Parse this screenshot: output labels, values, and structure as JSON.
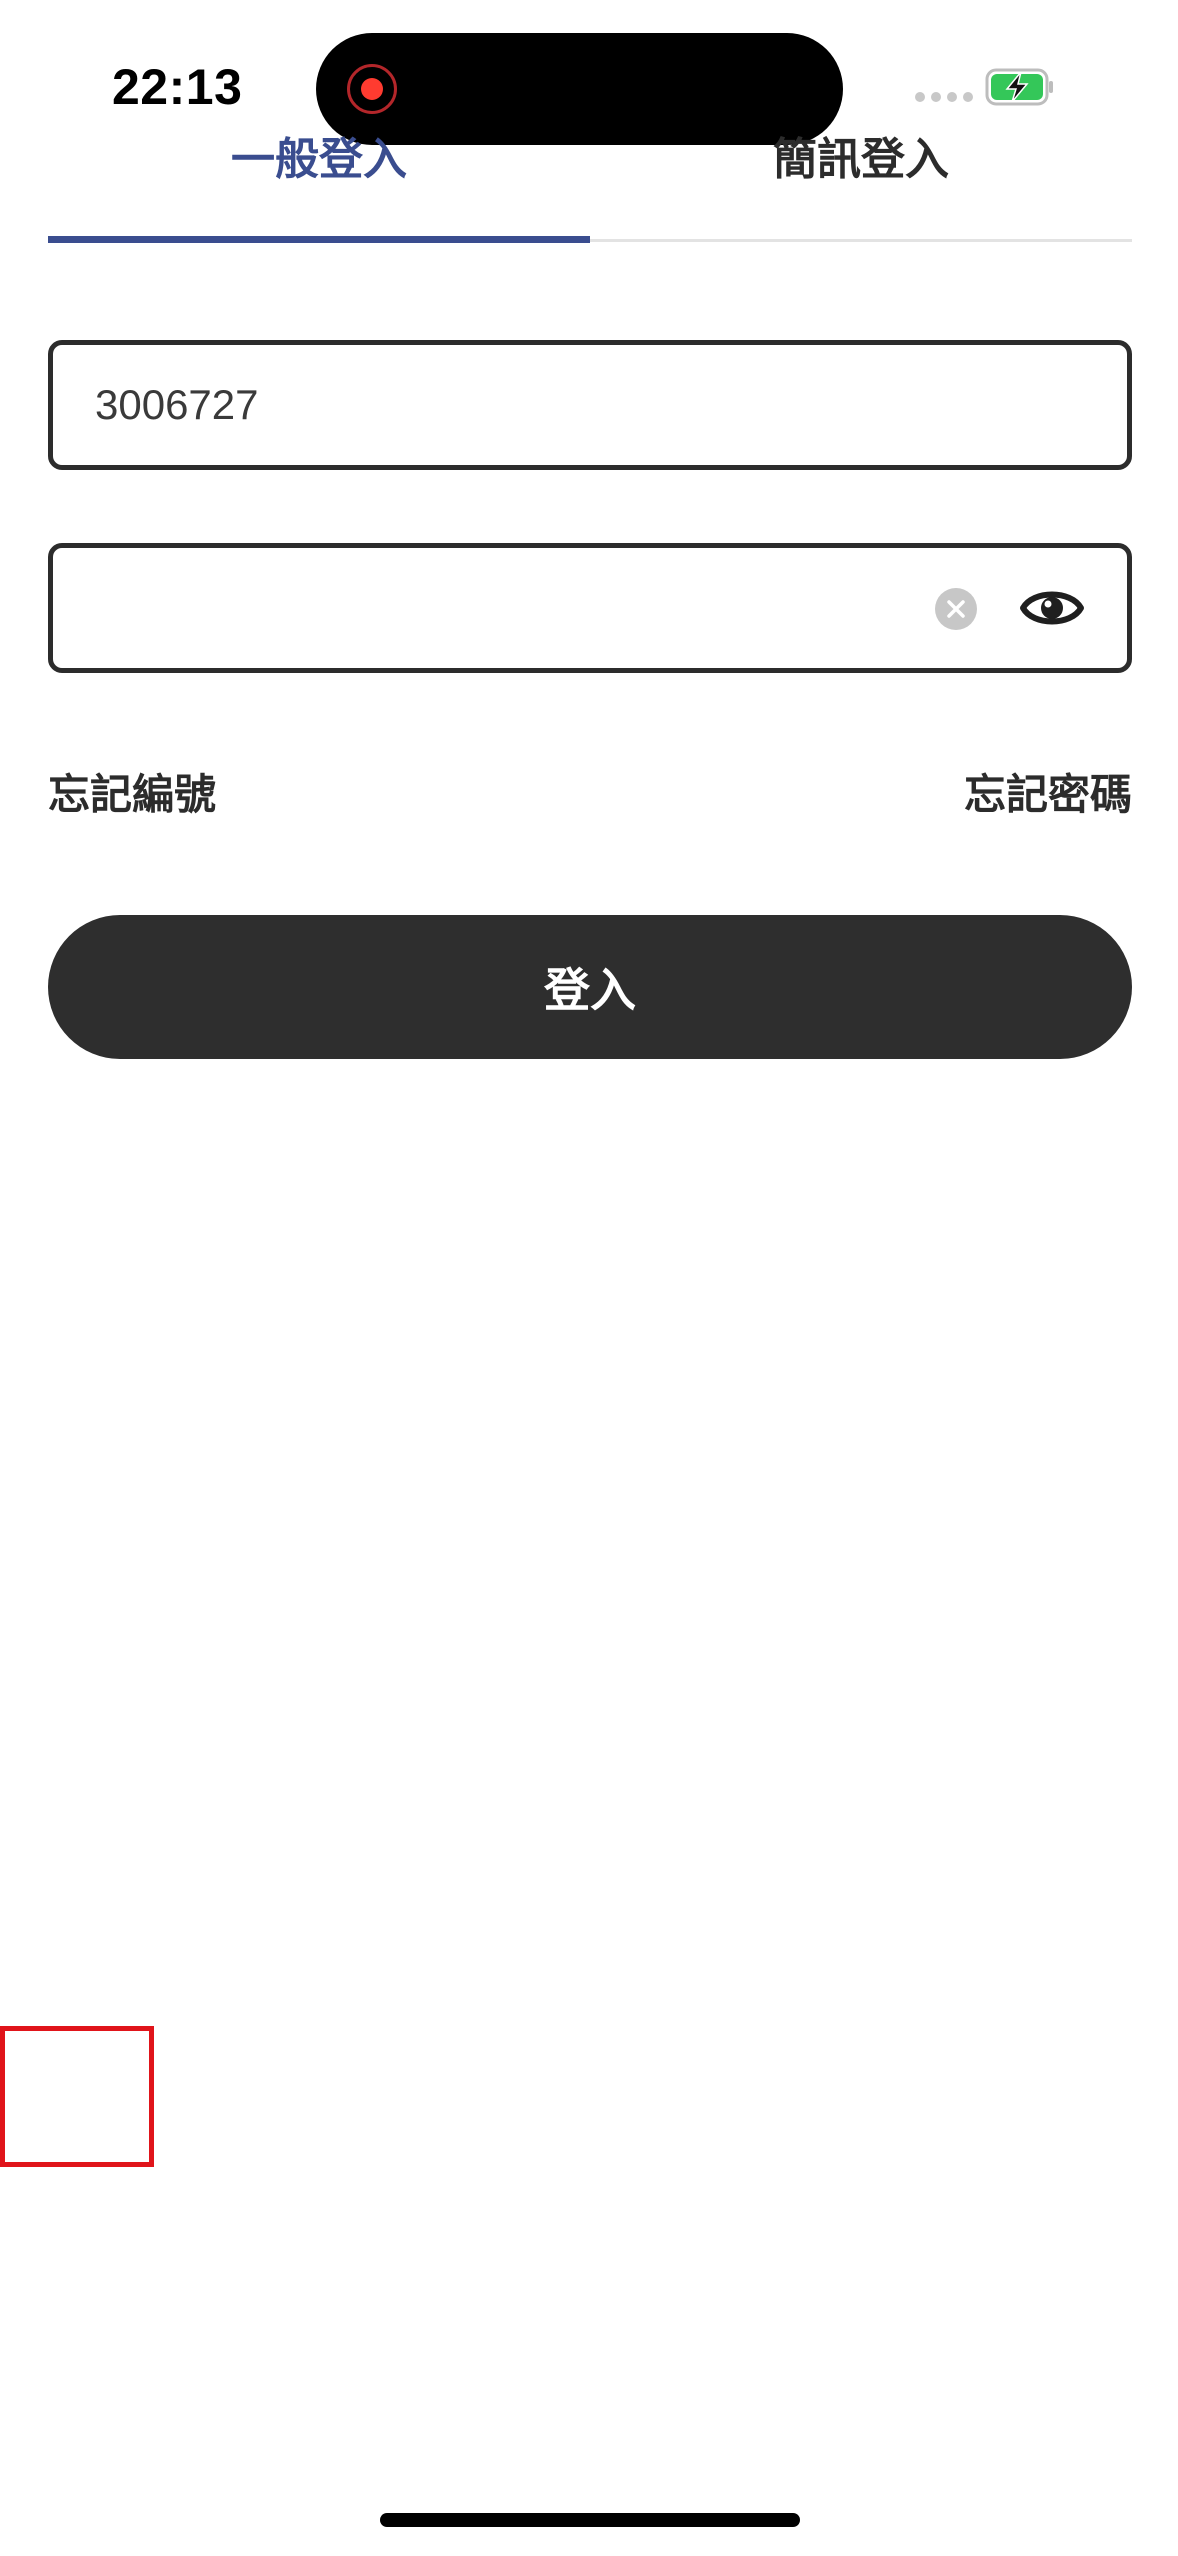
{
  "status_bar": {
    "time": "22:13",
    "recording": true,
    "battery_charging": true,
    "battery_color": "#34c759"
  },
  "tabs": [
    {
      "label": "一般登入",
      "active": true
    },
    {
      "label": "簡訊登入",
      "active": false
    }
  ],
  "form": {
    "account_value": "3006727",
    "password_value": "",
    "clear_icon": "clear-icon",
    "show_password_icon": "eye-icon"
  },
  "links": {
    "forgot_id": "忘記編號",
    "forgot_password": "忘記密碼"
  },
  "login_button": {
    "label": "登入"
  },
  "colors": {
    "accent": "#3a4d8f",
    "button": "#2e2e2e",
    "text": "#2c2c2c",
    "overlay_box": "#e0141a"
  }
}
